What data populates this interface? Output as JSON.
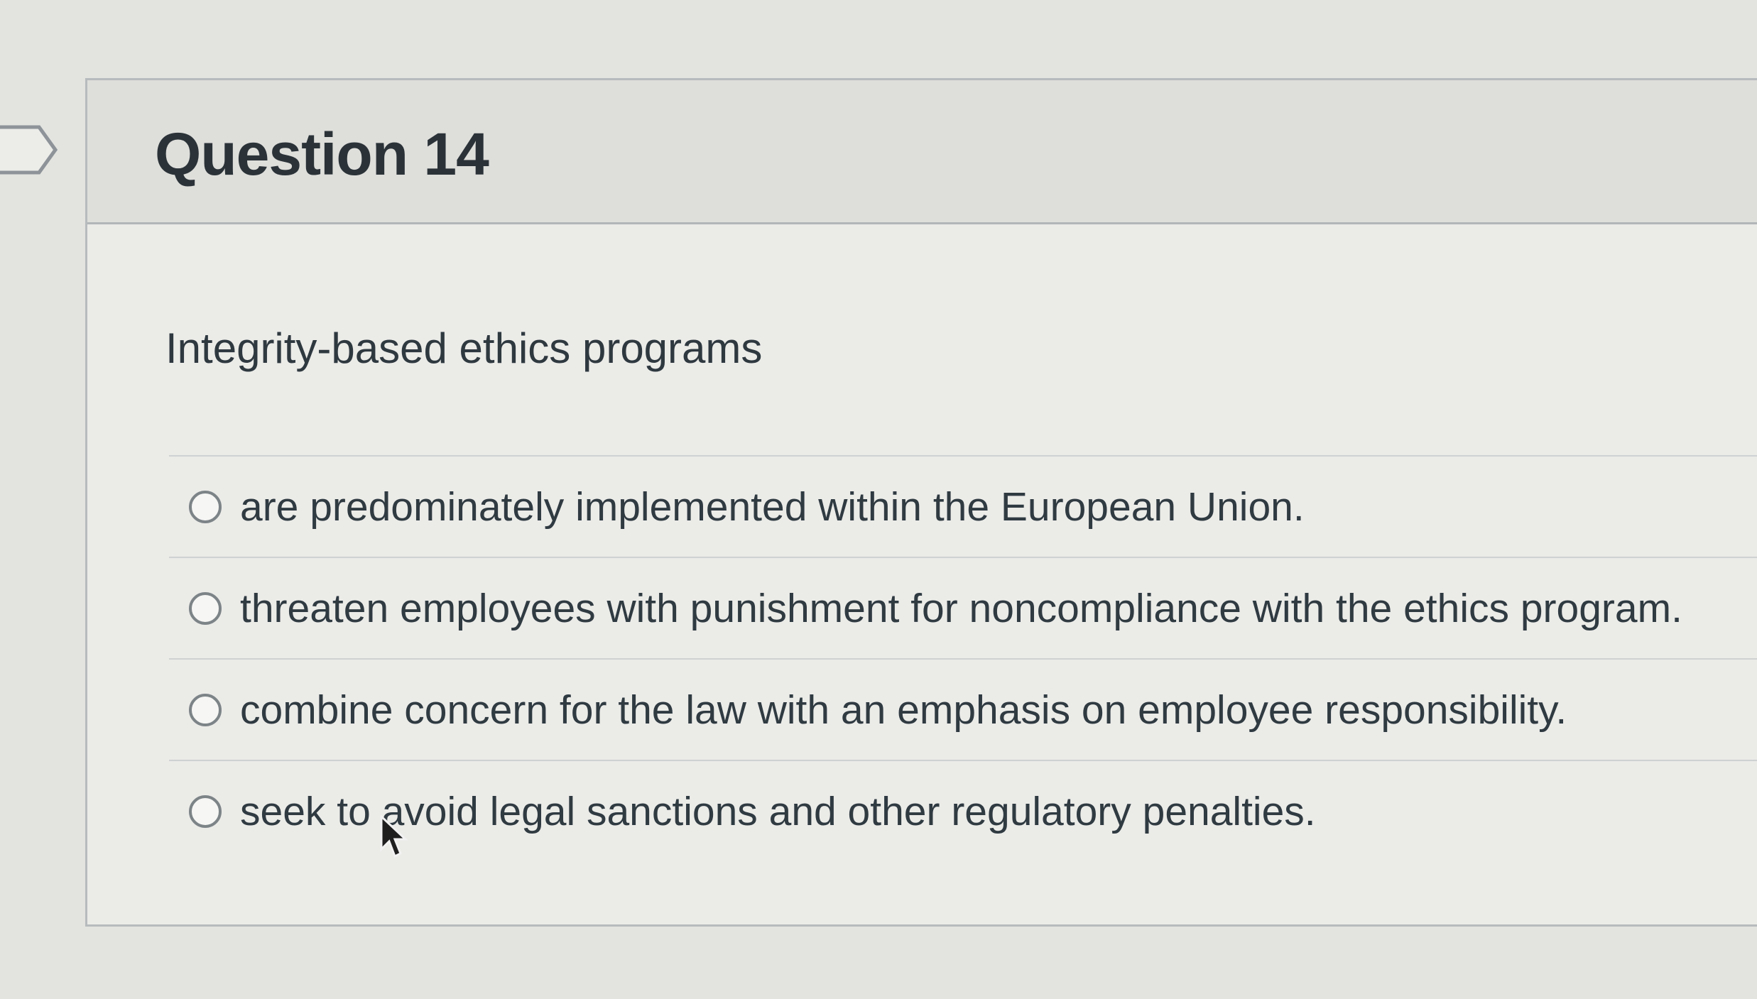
{
  "question": {
    "title": "Question 14",
    "text": "Integrity-based ethics programs"
  },
  "answers": [
    {
      "label": "are predominately implemented within the European Union."
    },
    {
      "label": "threaten employees with punishment for noncompliance with the ethics program."
    },
    {
      "label": "combine concern for the law with an emphasis on employee responsibility."
    },
    {
      "label": "seek to avoid legal sanctions and other regulatory penalties."
    }
  ],
  "icons": {
    "flag": "flag-question-icon",
    "cursor": "mouse-pointer-icon"
  }
}
